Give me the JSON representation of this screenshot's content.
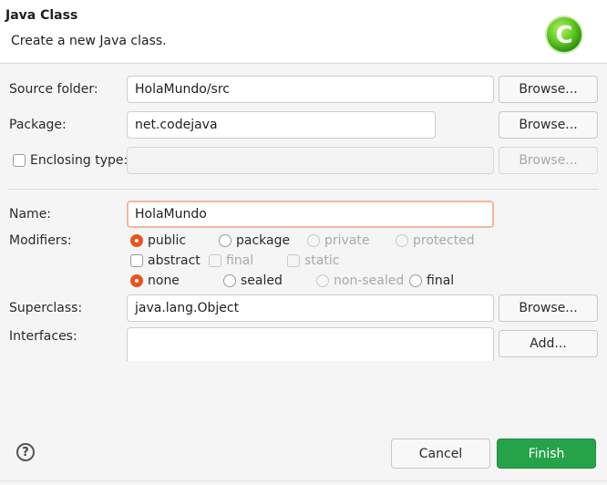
{
  "header": {
    "title": "Java Class",
    "subtitle": "Create a new Java class.",
    "logo_letter": "C"
  },
  "form": {
    "source_folder": {
      "label": "Source folder:",
      "value": "HolaMundo/src",
      "browse": "Browse..."
    },
    "package": {
      "label": "Package:",
      "value": "net.codejava",
      "browse": "Browse..."
    },
    "enclosing_type": {
      "label": "Enclosing type:",
      "value": "",
      "browse": "Browse...",
      "checked": false
    },
    "name": {
      "label": "Name:",
      "value": "HolaMundo"
    },
    "modifiers": {
      "label": "Modifiers:",
      "access": [
        {
          "label": "public",
          "selected": true,
          "enabled": true
        },
        {
          "label": "package",
          "selected": false,
          "enabled": true
        },
        {
          "label": "private",
          "selected": false,
          "enabled": false
        },
        {
          "label": "protected",
          "selected": false,
          "enabled": false
        }
      ],
      "flags": [
        {
          "label": "abstract",
          "checked": false,
          "enabled": true
        },
        {
          "label": "final",
          "checked": false,
          "enabled": false
        },
        {
          "label": "static",
          "checked": false,
          "enabled": false
        }
      ],
      "sealing": [
        {
          "label": "none",
          "selected": true,
          "enabled": true
        },
        {
          "label": "sealed",
          "selected": false,
          "enabled": true
        },
        {
          "label": "non-sealed",
          "selected": false,
          "enabled": false
        },
        {
          "label": "final",
          "selected": false,
          "enabled": true
        }
      ]
    },
    "superclass": {
      "label": "Superclass:",
      "value": "java.lang.Object",
      "browse": "Browse..."
    },
    "interfaces": {
      "label": "Interfaces:",
      "add": "Add..."
    }
  },
  "footer": {
    "help": "?",
    "cancel": "Cancel",
    "finish": "Finish"
  },
  "colors": {
    "accent_radio": "#e9541d",
    "finish_button": "#26a348",
    "logo_green": "#4cbf1c"
  }
}
